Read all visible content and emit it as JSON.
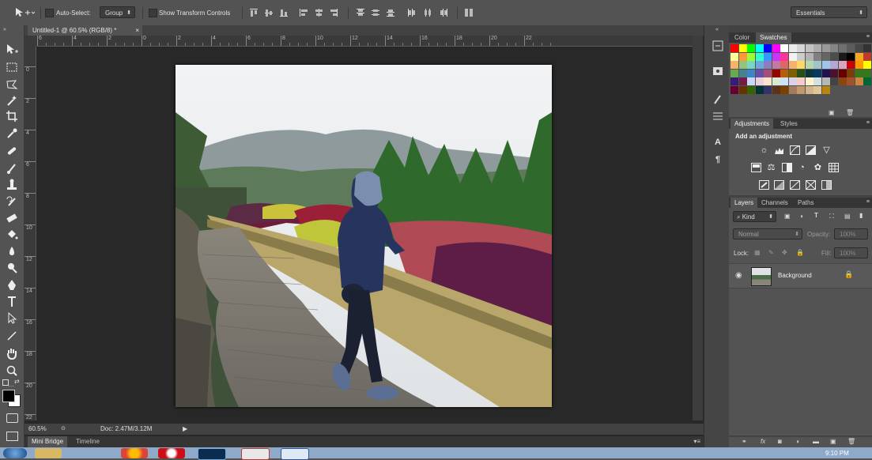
{
  "options_bar": {
    "auto_select_label": "Auto-Select:",
    "auto_select_value": "Group",
    "transform_label": "Show Transform Controls",
    "workspace": "Essentials"
  },
  "document": {
    "tab_title": "Untitled-1 @ 60.5% (RGB/8) *",
    "close_glyph": "×",
    "ruler_h_ticks": [
      "6",
      "4",
      "2",
      "0",
      "2",
      "4",
      "6",
      "8",
      "10",
      "12",
      "14",
      "16",
      "18",
      "20",
      "22"
    ],
    "ruler_v_ticks": [
      "0",
      "2",
      "4",
      "6",
      "8",
      "10",
      "12",
      "14",
      "16",
      "18",
      "20",
      "22"
    ],
    "zoom": "60.5%",
    "doc_info": "Doc: 2.47M/3.12M"
  },
  "bottom_tabs": [
    "Mini Bridge",
    "Timeline"
  ],
  "panels": {
    "swatch_tabs": [
      "Color",
      "Swatches"
    ],
    "swatch_colors": [
      "#ff0000",
      "#ffff00",
      "#00ff00",
      "#00ffff",
      "#0000ff",
      "#ff00ff",
      "#ffffff",
      "#ebebeb",
      "#d6d6d6",
      "#c2c2c2",
      "#adadad",
      "#999999",
      "#858585",
      "#707070",
      "#5c5c5c",
      "#474747",
      "#333333",
      "#1f1f1f",
      "#ff0000",
      "#ffff99",
      "#ff9933",
      "#99ff33",
      "#33ffcc",
      "#3399ff",
      "#cc33ff",
      "#ff3399",
      "#f2f2f2",
      "#cccccc",
      "#b3b3b3",
      "#808080",
      "#666666",
      "#4d4d4d",
      "#1a1a1a",
      "#000000",
      "#f5a623",
      "#c0392b",
      "#ff6666",
      "#f4e04d",
      "#f6b26b",
      "#93c47d",
      "#76d7c4",
      "#6fa8dc",
      "#8e7cc3",
      "#c27ba0",
      "#e06666",
      "#f6b26b",
      "#ffd966",
      "#b6d7a8",
      "#a2c4c9",
      "#9fc5e8",
      "#b4a7d6",
      "#d5a6bd",
      "#cc0000",
      "#ff9900",
      "#ffff00",
      "#e69138",
      "#bf9000",
      "#6aa84f",
      "#45818e",
      "#3d85c6",
      "#674ea7",
      "#a64d79",
      "#990000",
      "#b45f06",
      "#7f6000",
      "#274e13",
      "#0c343d",
      "#073763",
      "#20124d",
      "#4c1130",
      "#660000",
      "#783f04",
      "#38761d",
      "#38761d",
      "#134f5c",
      "#0b5394",
      "#351c75",
      "#741b47",
      "#c9daf8",
      "#ead1dc",
      "#fce5cd",
      "#d9ead3",
      "#cfe2f3",
      "#d9d2e9",
      "#f4cccc",
      "#fff2cc",
      "#d0e0e3",
      "#b7b7b7",
      "#434343",
      "#8b4513",
      "#a0522d",
      "#cd853f",
      "#006633",
      "#003366",
      "#330066",
      "#660033",
      "#663300",
      "#336600",
      "#003333",
      "#333366",
      "#5c3317",
      "#7b3f00",
      "#a67b5b",
      "#c19a6b",
      "#d2b48c",
      "#e1c699",
      "#b8860b"
    ],
    "adjust_tabs": [
      "Adjustments",
      "Styles"
    ],
    "adjust_heading": "Add an adjustment",
    "layers_tabs": [
      "Layers",
      "Channels",
      "Paths"
    ],
    "kind_label": "Kind",
    "blend_mode": "Normal",
    "opacity_label": "Opacity:",
    "opacity_value": "100%",
    "lock_label": "Lock:",
    "fill_label": "Fill:",
    "fill_value": "100%",
    "layer_name": "Background"
  },
  "taskbar": {
    "time": "9:10 PM"
  }
}
